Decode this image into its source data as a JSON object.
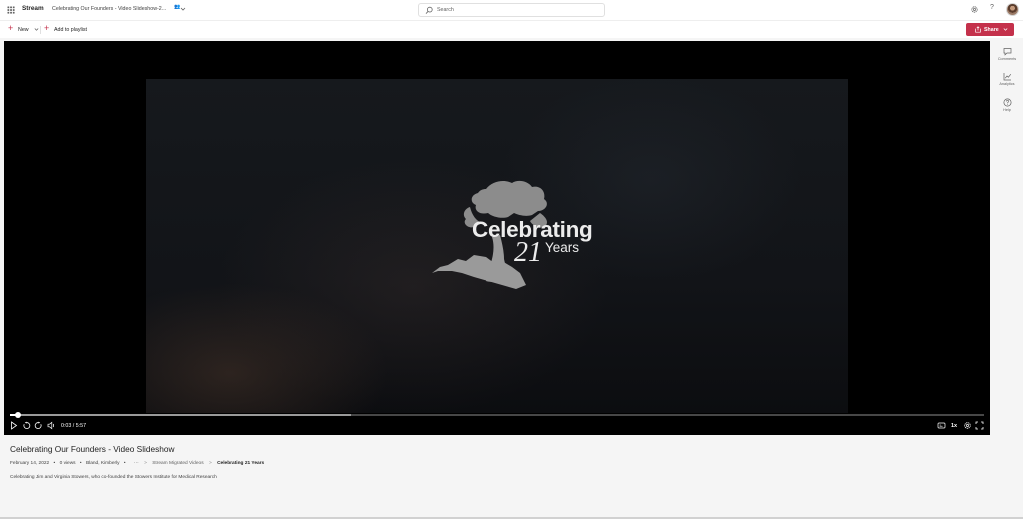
{
  "header": {
    "app_name": "Stream",
    "document_title": "Celebrating Our Founders - Video Slideshow-2...",
    "search_placeholder": "Search"
  },
  "toolbar": {
    "new_label": "New",
    "add_to_playlist_label": "Add to playlist",
    "share_label": "Share"
  },
  "video": {
    "logo_word": "Celebrating",
    "logo_number": "21",
    "logo_years": "Years",
    "current_time": "0:03",
    "duration": "5:57",
    "time_display": "0:03 / 5:57",
    "progress_fraction": 0.0084,
    "buffered_fraction": 0.35,
    "speed_label": "1x"
  },
  "rail": {
    "comments_label": "Comments",
    "analytics_label": "Analytics",
    "help_label": "Help"
  },
  "info": {
    "title": "Celebrating Our Founders - Video Slideshow",
    "date": "February 14, 2022",
    "views": "0 views",
    "author": "Bland, Kimberly",
    "more": "···",
    "breadcrumb": [
      "Stream Migrated Videos",
      "Celebrating 21 Years"
    ],
    "description": "Celebrating Jim and Virginia Stowers, who co-founded the Stowers Institute for Medical Research"
  },
  "colors": {
    "accent": "#c4314b",
    "page_background": "#f5f5f5",
    "player_background": "#000000"
  },
  "icons": [
    "app-launcher-icon",
    "search-icon",
    "settings-icon",
    "help-icon",
    "share-icon",
    "play-icon",
    "rewind-icon",
    "forward-icon",
    "volume-icon",
    "captions-icon",
    "fullscreen-icon",
    "comments-icon",
    "analytics-icon"
  ]
}
